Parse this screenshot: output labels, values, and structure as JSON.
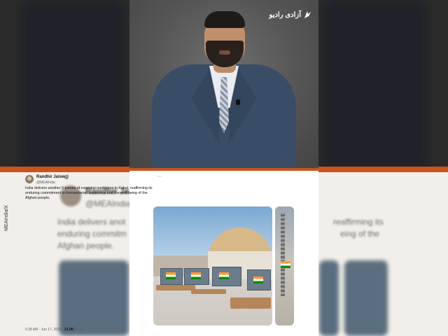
{
  "brand": {
    "logo_text": "آزادی رادیو",
    "accent": "#c8531c"
  },
  "tweet": {
    "author_name": "Randhir Jaiswal",
    "handle": "@MEAIndia",
    "body": "India delivers another 5 tonnes of essential medicines to Kabul, reaffirming its enduring commitment to humanitarian assistance and the well-being of the Afghan people.",
    "time": "6:38 AM · Jun 17, 2026 · ",
    "views_count": "21.9K",
    "views_label": " Views",
    "more_label": "···",
    "verified_icon": "✓"
  },
  "source_label": "MEAIndia/X",
  "background": {
    "name": "Randhir Ja",
    "handle": "@MEAIndia",
    "line1_left": "India delivers anot",
    "line1_right": "reaffirming its",
    "line2_left": "enduring commitm",
    "line2_right": "eing of the",
    "line3": "Afghan people."
  }
}
